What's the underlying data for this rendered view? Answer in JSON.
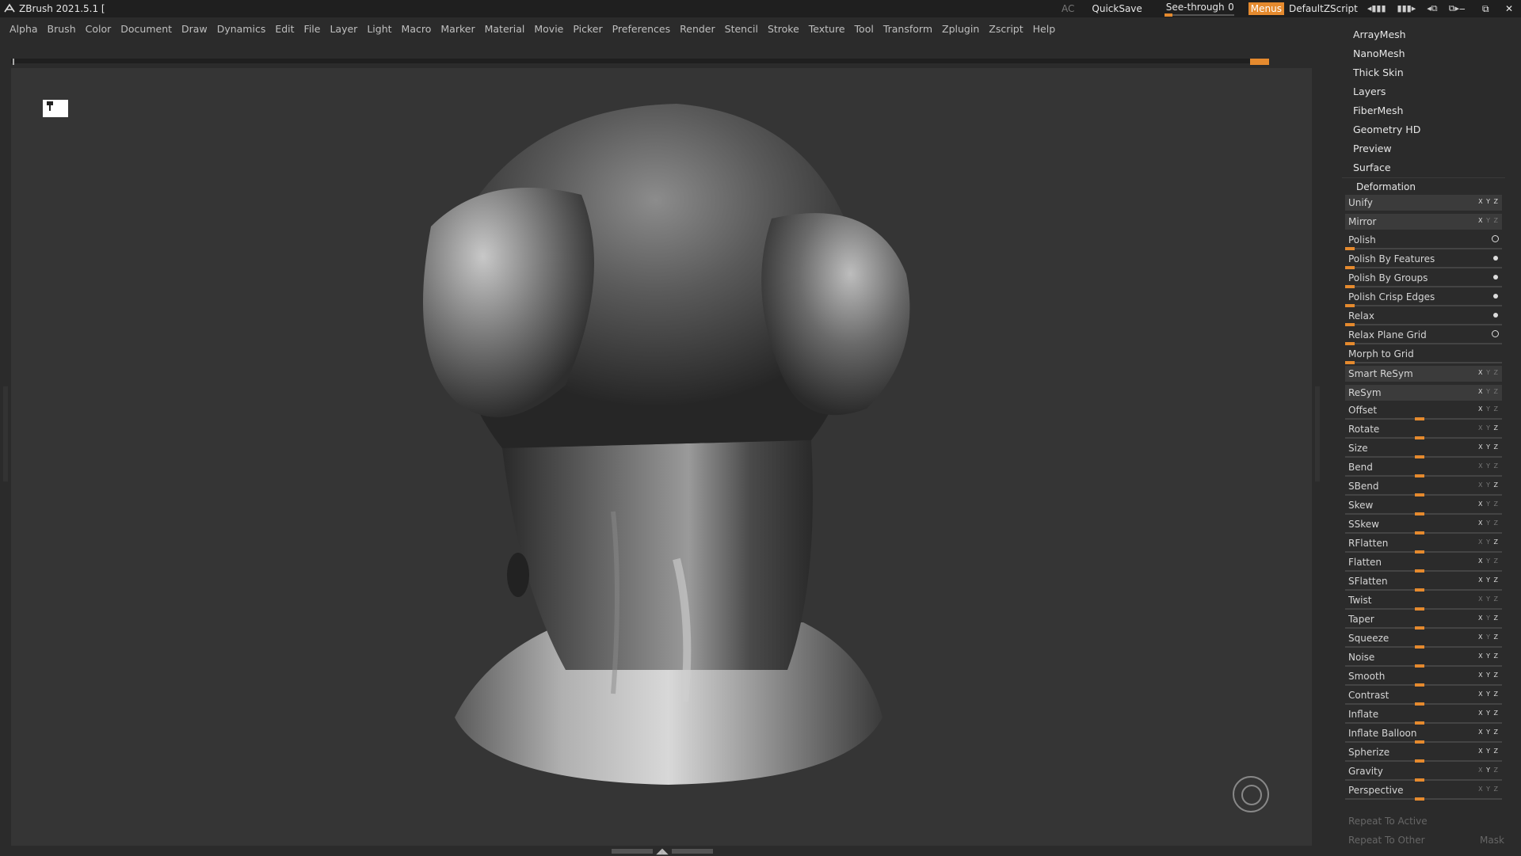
{
  "app": {
    "title": "ZBrush 2021.5.1 [",
    "ac_label": "AC",
    "quicksave_label": "QuickSave",
    "seethrough_label": "See-through",
    "seethrough_value": "0",
    "menus_label": "Menus",
    "zscript_label": "DefaultZScript"
  },
  "menubar": {
    "items": [
      "Alpha",
      "Brush",
      "Color",
      "Document",
      "Draw",
      "Dynamics",
      "Edit",
      "File",
      "Layer",
      "Light",
      "Macro",
      "Marker",
      "Material",
      "Movie",
      "Picker",
      "Preferences",
      "Render",
      "Stencil",
      "Stroke",
      "Texture",
      "Tool",
      "Transform",
      "Zplugin",
      "Zscript",
      "Help"
    ]
  },
  "panel": {
    "subpalettes": [
      "ArrayMesh",
      "NanoMesh",
      "Thick Skin",
      "Layers",
      "FiberMesh",
      "Geometry HD",
      "Preview",
      "Surface"
    ],
    "deformation_title": "Deformation",
    "unify": "Unify",
    "mirror": "Mirror",
    "polish": "Polish",
    "polish_by_features": "Polish By Features",
    "polish_by_groups": "Polish By Groups",
    "polish_crisp_edges": "Polish Crisp Edges",
    "relax": "Relax",
    "relax_plane_grid": "Relax Plane Grid",
    "morph_to_grid": "Morph to Grid",
    "smart_resym": "Smart ReSym",
    "resym": "ReSym",
    "sliders": [
      "Offset",
      "Rotate",
      "Size",
      "Bend",
      "SBend",
      "Skew",
      "SSkew",
      "RFlatten",
      "Flatten",
      "SFlatten",
      "Twist",
      "Taper",
      "Squeeze",
      "Noise",
      "Smooth",
      "Contrast",
      "Inflate",
      "Inflate Balloon",
      "Spherize",
      "Gravity",
      "Perspective"
    ],
    "repeat_to_active": "Repeat To Active",
    "repeat_to_other": "Repeat To Other",
    "mask": "Mask"
  },
  "colors": {
    "accent": "#e58a2e",
    "background": "#2b2b2b",
    "viewport": "#353535"
  }
}
